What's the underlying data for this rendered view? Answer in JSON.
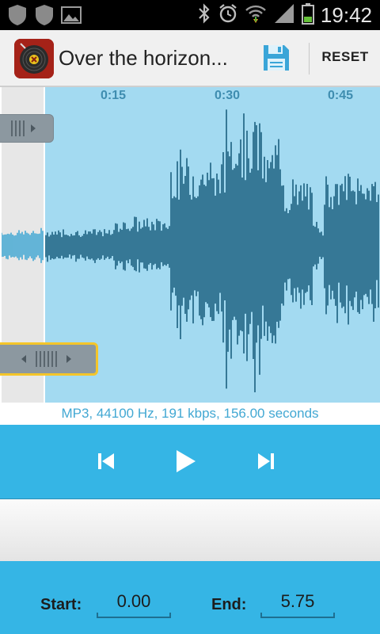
{
  "status_bar": {
    "time": "19:42",
    "left_icons": [
      "shield-icon",
      "shield-icon",
      "image-icon"
    ],
    "right_icons": [
      "bluetooth-icon",
      "alarm-icon",
      "wifi-icon",
      "signal-icon",
      "battery-icon"
    ]
  },
  "action_bar": {
    "title": "Over the horizon...",
    "save_icon": "save-icon",
    "reset_label": "RESET"
  },
  "timeline": {
    "ticks": [
      "0:15",
      "0:30",
      "0:45"
    ]
  },
  "file_info": "MP3, 44100 Hz, 191 kbps, 156.00 seconds",
  "transport": {
    "prev_icon": "skip-previous-icon",
    "play_icon": "play-icon",
    "next_icon": "skip-next-icon"
  },
  "selection": {
    "start_label": "Start:",
    "start_value": "0.00",
    "end_label": "End:",
    "end_value": "5.75"
  },
  "colors": {
    "accent": "#35b5e5",
    "waveform_selected": "#1b6080",
    "waveform_unselected": "#42a8d3",
    "selection_bg": "#a3daf1",
    "handle_highlight": "#f4c52a"
  }
}
